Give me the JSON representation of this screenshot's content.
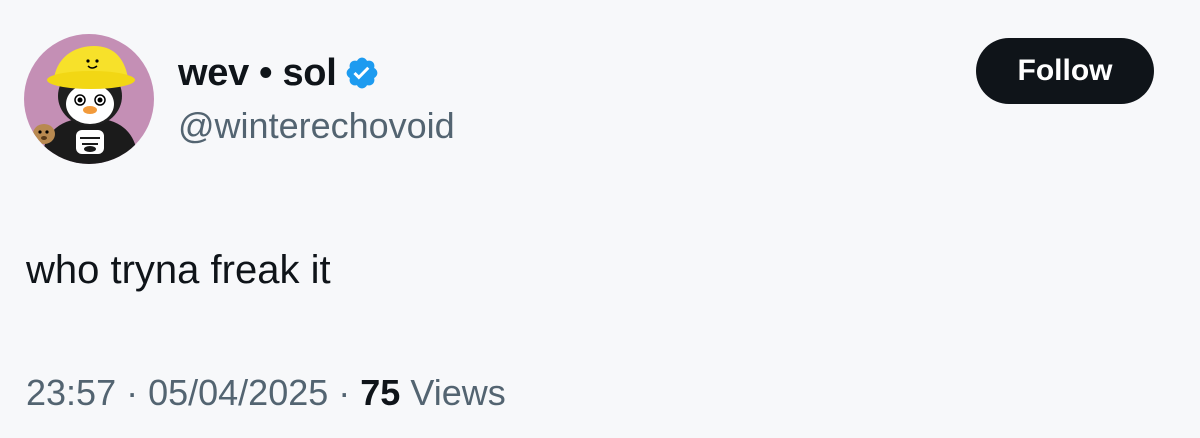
{
  "author": {
    "display_name": "wev • sol",
    "handle": "@winterechovoid",
    "verified": true,
    "avatar_icon": "penguin-bucket-hat-avatar"
  },
  "actions": {
    "follow_label": "Follow"
  },
  "tweet": {
    "text": "who tryna freak it"
  },
  "meta": {
    "time": "23:57",
    "separator": " · ",
    "date": "05/04/2025",
    "views_count": "75",
    "views_label": "Views"
  },
  "colors": {
    "background": "#f7f8fa",
    "text_primary": "#0f1419",
    "text_secondary": "#536471",
    "verified_badge": "#1d9bf0",
    "follow_button_bg": "#0f1419",
    "follow_button_text": "#ffffff"
  }
}
